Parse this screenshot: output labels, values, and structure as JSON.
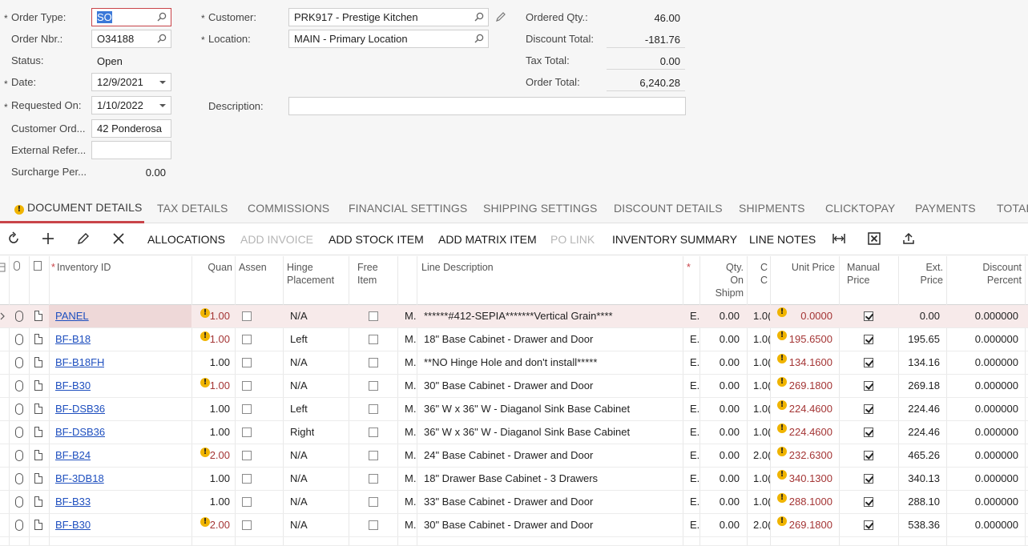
{
  "form": {
    "order_type": {
      "label": "Order Type:",
      "value": "SO"
    },
    "order_nbr": {
      "label": "Order Nbr.:",
      "value": "O34188"
    },
    "status": {
      "label": "Status:",
      "value": "Open"
    },
    "date": {
      "label": "Date:",
      "value": "12/9/2021"
    },
    "requested_on": {
      "label": "Requested On:",
      "value": "1/10/2022"
    },
    "customer_ord": {
      "label": "Customer Ord...",
      "value": "42 Ponderosa"
    },
    "external_ref": {
      "label": "External Refer...",
      "value": ""
    },
    "surcharge": {
      "label": "Surcharge Per...",
      "value": "0.00"
    },
    "customer": {
      "label": "Customer:",
      "value": "PRK917 - Prestige Kitchen"
    },
    "location": {
      "label": "Location:",
      "value": "MAIN - Primary Location"
    },
    "description": {
      "label": "Description:",
      "value": ""
    },
    "ordered_qty": {
      "label": "Ordered Qty.:",
      "value": "46.00"
    },
    "discount_total": {
      "label": "Discount Total:",
      "value": "-181.76"
    },
    "tax_total": {
      "label": "Tax Total:",
      "value": "0.00"
    },
    "order_total": {
      "label": "Order Total:",
      "value": "6,240.28"
    },
    "required_marker": "*"
  },
  "tabs": [
    {
      "label": "DOCUMENT DETAILS",
      "active": true
    },
    {
      "label": "TAX DETAILS"
    },
    {
      "label": "COMMISSIONS"
    },
    {
      "label": "FINANCIAL SETTINGS"
    },
    {
      "label": "SHIPPING SETTINGS"
    },
    {
      "label": "DISCOUNT DETAILS"
    },
    {
      "label": "SHIPMENTS"
    },
    {
      "label": "CLICKTOPAY"
    },
    {
      "label": "PAYMENTS"
    },
    {
      "label": "TOTAL"
    }
  ],
  "toolbar": {
    "allocations": "ALLOCATIONS",
    "add_invoice": "ADD INVOICE",
    "add_stock_item": "ADD STOCK ITEM",
    "add_matrix_item": "ADD MATRIX ITEM",
    "po_link": "PO LINK",
    "inventory_summary": "INVENTORY SUMMARY",
    "line_notes": "LINE NOTES"
  },
  "columns": {
    "inventory_id": "Inventory ID",
    "quantity": "Quan",
    "assembly": "Assen",
    "hinge_1": "Hinge",
    "hinge_2": "Placement",
    "free_1": "Free",
    "free_2": "Item",
    "line_description": "Line Description",
    "qty_on_1": "Qty.",
    "qty_on_2": "On",
    "qty_on_3": "Shipm",
    "c_1": "C",
    "c_2": "C",
    "unit_price": "Unit Price",
    "manual_1": "Manual",
    "manual_2": "Price",
    "ext_1": "Ext.",
    "ext_2": "Price",
    "disc_1": "Discount",
    "disc_2": "Percent",
    "req_star": "*"
  },
  "rows": [
    {
      "id": "PANEL",
      "qty": "1.00",
      "qty_warn": true,
      "hinge": "N/A",
      "m": "M.",
      "desc": "******#412-SEPIA*******Vertical Grain****",
      "e": "E.",
      "qty_on": "0.00",
      "c": "1.0(",
      "unit": "0.0000",
      "unit_warn": true,
      "ext": "0.00",
      "disc": "0.000000"
    },
    {
      "id": "BF-B18",
      "qty": "1.00",
      "qty_warn": true,
      "hinge": "Left",
      "m": "M.",
      "desc": "18\" Base Cabinet - Drawer and Door",
      "e": "E.",
      "qty_on": "0.00",
      "c": "1.0(",
      "unit": "195.6500",
      "unit_warn": true,
      "ext": "195.65",
      "disc": "0.000000"
    },
    {
      "id": "BF-B18FH",
      "qty": "1.00",
      "qty_warn": false,
      "hinge": "N/A",
      "m": "M.",
      "desc": "**NO Hinge Hole and don't install*****",
      "e": "E.",
      "qty_on": "0.00",
      "c": "1.0(",
      "unit": "134.1600",
      "unit_warn": true,
      "ext": "134.16",
      "disc": "0.000000"
    },
    {
      "id": "BF-B30",
      "qty": "1.00",
      "qty_warn": true,
      "hinge": "N/A",
      "m": "M.",
      "desc": "30\" Base Cabinet - Drawer and Door",
      "e": "E.",
      "qty_on": "0.00",
      "c": "1.0(",
      "unit": "269.1800",
      "unit_warn": true,
      "ext": "269.18",
      "disc": "0.000000"
    },
    {
      "id": "BF-DSB36",
      "qty": "1.00",
      "qty_warn": false,
      "hinge": "Left",
      "m": "M.",
      "desc": "36\" W x 36\" W - Diaganol Sink Base Cabinet",
      "e": "E.",
      "qty_on": "0.00",
      "c": "1.0(",
      "unit": "224.4600",
      "unit_warn": true,
      "ext": "224.46",
      "disc": "0.000000"
    },
    {
      "id": "BF-DSB36",
      "qty": "1.00",
      "qty_warn": false,
      "hinge": "Right",
      "m": "M.",
      "desc": "36\" W x 36\" W - Diaganol Sink Base Cabinet",
      "e": "E.",
      "qty_on": "0.00",
      "c": "1.0(",
      "unit": "224.4600",
      "unit_warn": true,
      "ext": "224.46",
      "disc": "0.000000"
    },
    {
      "id": "BF-B24",
      "qty": "2.00",
      "qty_warn": true,
      "hinge": "N/A",
      "m": "M.",
      "desc": "24\" Base Cabinet - Drawer and Door",
      "e": "E.",
      "qty_on": "0.00",
      "c": "2.0(",
      "unit": "232.6300",
      "unit_warn": true,
      "ext": "465.26",
      "disc": "0.000000"
    },
    {
      "id": "BF-3DB18",
      "qty": "1.00",
      "qty_warn": false,
      "hinge": "N/A",
      "m": "M.",
      "desc": "18\" Drawer Base Cabinet - 3 Drawers",
      "e": "E.",
      "qty_on": "0.00",
      "c": "1.0(",
      "unit": "340.1300",
      "unit_warn": true,
      "ext": "340.13",
      "disc": "0.000000"
    },
    {
      "id": "BF-B33",
      "qty": "1.00",
      "qty_warn": false,
      "hinge": "N/A",
      "m": "M.",
      "desc": "33\" Base Cabinet - Drawer and Door",
      "e": "E.",
      "qty_on": "0.00",
      "c": "1.0(",
      "unit": "288.1000",
      "unit_warn": true,
      "ext": "288.10",
      "disc": "0.000000"
    },
    {
      "id": "BF-B30",
      "qty": "2.00",
      "qty_warn": true,
      "hinge": "N/A",
      "m": "M.",
      "desc": "30\" Base Cabinet - Drawer and Door",
      "e": "E.",
      "qty_on": "0.00",
      "c": "2.0(",
      "unit": "269.1800",
      "unit_warn": true,
      "ext": "538.36",
      "disc": "0.000000"
    }
  ],
  "colors": {
    "accent": "#c94449",
    "link": "#1e4fbf",
    "warn": "#f0b400",
    "price_red": "#a43535"
  }
}
